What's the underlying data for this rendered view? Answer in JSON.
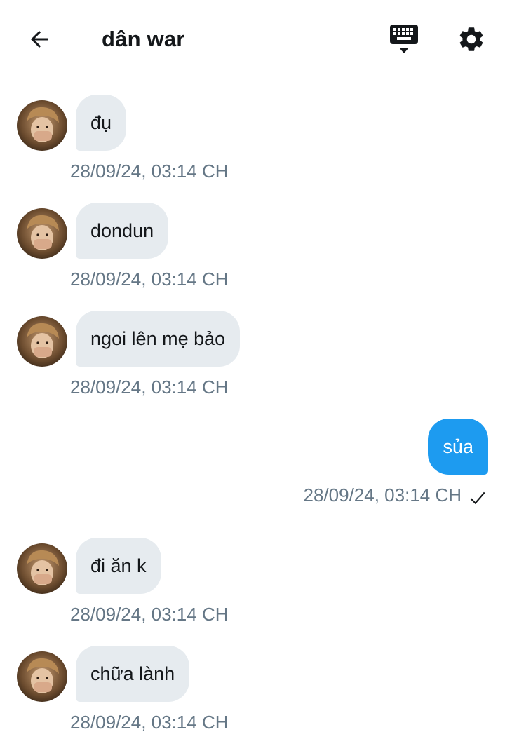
{
  "header": {
    "title": "dân war",
    "back_icon": "arrow-left-icon",
    "keyboard_icon": "keyboard-icon",
    "settings_icon": "gear-icon"
  },
  "messages": [
    {
      "direction": "in",
      "text": "đụ",
      "time": "28/09/24, 03:14 CH"
    },
    {
      "direction": "in",
      "text": "dondun",
      "time": "28/09/24, 03:14 CH"
    },
    {
      "direction": "in",
      "text": "ngoi lên mẹ bảo",
      "time": "28/09/24, 03:14 CH"
    },
    {
      "direction": "out",
      "text": "sủa",
      "time": "28/09/24, 03:14 CH",
      "status_icon": "checkmark-icon"
    },
    {
      "direction": "in",
      "text": "đi ăn k",
      "time": "28/09/24, 03:14 CH"
    },
    {
      "direction": "in",
      "text": "chữa lành",
      "time": "28/09/24, 03:14 CH"
    }
  ],
  "colors": {
    "incoming_bubble": "#e6ebef",
    "outgoing_bubble": "#1d9bf0",
    "timestamp": "#657786",
    "text": "#14171a"
  }
}
